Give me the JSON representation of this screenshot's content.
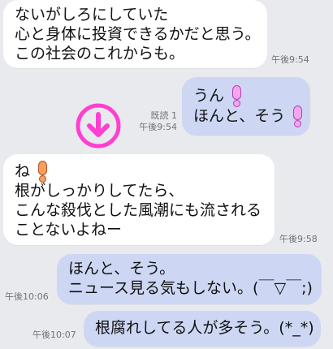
{
  "colors": {
    "background": "#e9eaee",
    "incoming_bubble": "#ffffff",
    "outgoing_bubble": "#cdd7f3",
    "accent_icon": "#ff3fd0"
  },
  "messages": [
    {
      "side": "incoming",
      "lines": [
        "ないがしろにしていた",
        "心と身体に投資できるかだと思う。",
        "この社会のこれからも。"
      ],
      "time": "午後9:54"
    },
    {
      "side": "outgoing",
      "lines": [
        "うん",
        "ほんと、そう"
      ],
      "read": "既読 1",
      "time": "午後9:54"
    },
    {
      "side": "incoming",
      "lines": [
        "ね",
        "根がしっかりしてたら、",
        "こんな殺伐とした風潮にも流される",
        "ことないよねー"
      ],
      "time": "午後9:58"
    },
    {
      "side": "outgoing",
      "lines": [
        "ほんと、そう。",
        "ニュース見る気もしない。(￣▽￣;)"
      ],
      "time": "午後10:06"
    },
    {
      "side": "outgoing",
      "lines": [
        "根腐れしてる人が多そう。(*_*)"
      ],
      "time": "午後10:07"
    }
  ],
  "overlay": {
    "icon": "down-arrow-circle-icon"
  }
}
